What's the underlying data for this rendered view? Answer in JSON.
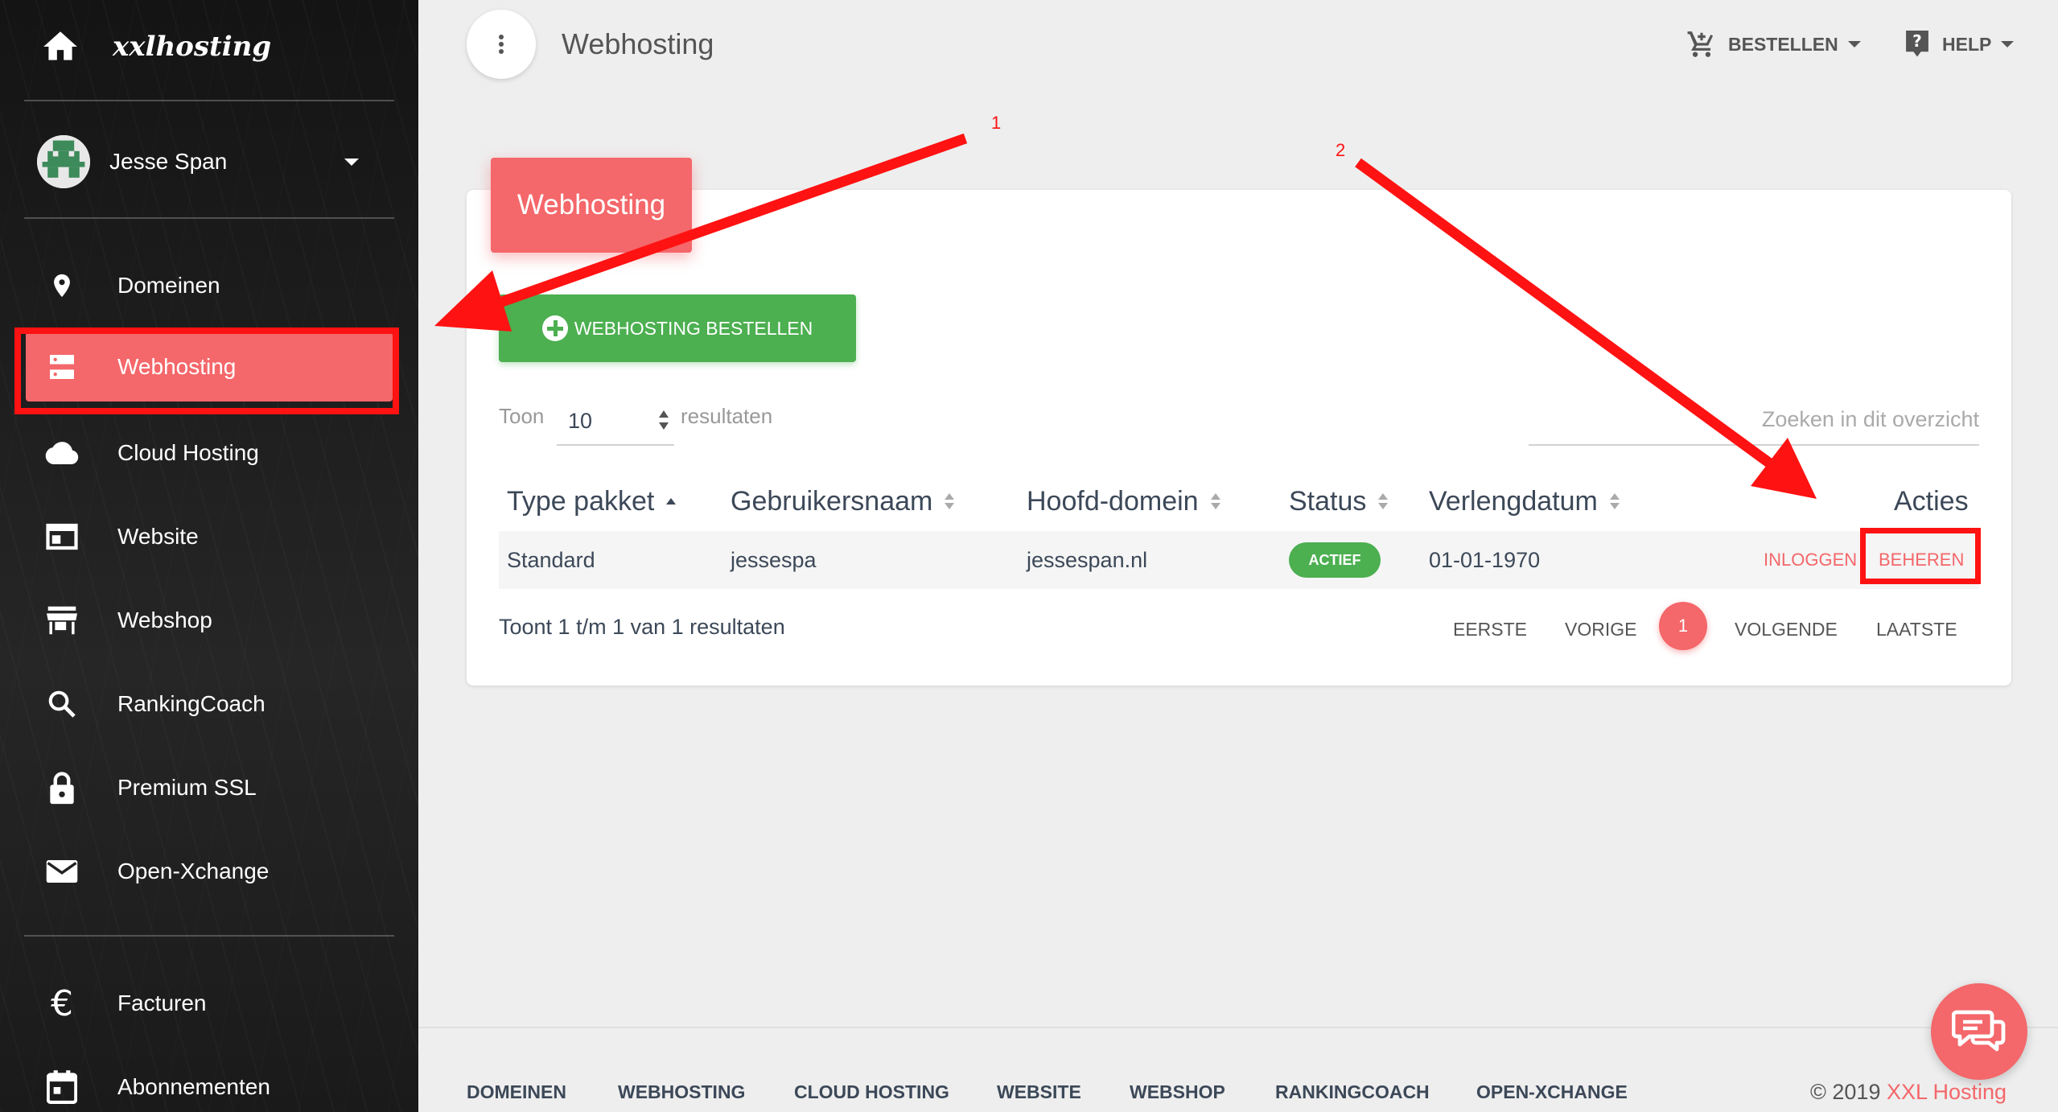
{
  "brand": {
    "name": "xxlhosting"
  },
  "user": {
    "name": "Jesse Span"
  },
  "sidebar": {
    "items": [
      {
        "label": "Domeinen",
        "icon": "location-pin-icon"
      },
      {
        "label": "Webhosting",
        "icon": "server-icon",
        "active": true
      },
      {
        "label": "Cloud Hosting",
        "icon": "cloud-icon"
      },
      {
        "label": "Website",
        "icon": "website-icon"
      },
      {
        "label": "Webshop",
        "icon": "store-icon"
      },
      {
        "label": "RankingCoach",
        "icon": "search-icon"
      },
      {
        "label": "Premium SSL",
        "icon": "lock-icon"
      },
      {
        "label": "Open-Xchange",
        "icon": "mail-icon"
      }
    ],
    "bottom_items": [
      {
        "label": "Facturen",
        "icon": "euro-icon"
      },
      {
        "label": "Abonnementen",
        "icon": "calendar-icon"
      }
    ]
  },
  "header": {
    "title": "Webhosting",
    "order_label": "BESTELLEN",
    "help_label": "HELP"
  },
  "card": {
    "title": "Webhosting",
    "order_button": "WEBHOSTING BESTELLEN",
    "show_label": "Toon",
    "show_value": "10",
    "results_label": "resultaten",
    "search_placeholder": "Zoeken in dit overzicht"
  },
  "table": {
    "columns": [
      "Type pakket",
      "Gebruikersnaam",
      "Hoofd-domein",
      "Status",
      "Verlengdatum",
      "Acties"
    ],
    "rows": [
      {
        "type": "Standard",
        "username": "jessespa",
        "domain": "jessespan.nl",
        "status": "ACTIEF",
        "renew_date": "01-01-1970",
        "action_login": "INLOGGEN",
        "action_manage": "BEHEREN"
      }
    ]
  },
  "pagination": {
    "summary": "Toont 1 t/m 1 van 1 resultaten",
    "first": "EERSTE",
    "prev": "VORIGE",
    "current": "1",
    "next": "VOLGENDE",
    "last": "LAATSTE"
  },
  "footer": {
    "links": [
      "DOMEINEN",
      "WEBHOSTING",
      "CLOUD HOSTING",
      "WEBSITE",
      "WEBSHOP",
      "RANKINGCOACH",
      "OPEN-XCHANGE"
    ],
    "copyright_prefix": "© 2019",
    "copyright_brand": "XXL Hosting"
  },
  "annotations": {
    "one": "1",
    "two": "2"
  },
  "colors": {
    "accent": "#f4676a",
    "success": "#4caf50",
    "annotation": "#ff1212",
    "sidebar": "#1e1e1e"
  }
}
